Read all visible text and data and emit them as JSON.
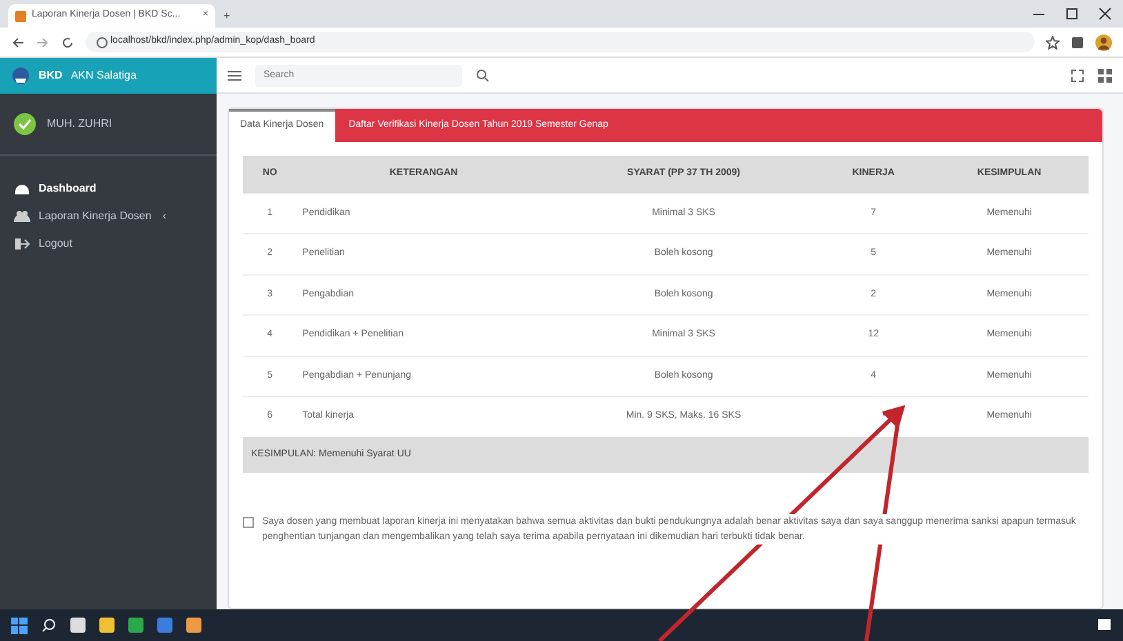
{
  "browser": {
    "tab_title": "Laporan Kinerja Dosen | BKD Sc...",
    "tab_close": "×",
    "new_tab": "+",
    "url": "localhost/bkd/index.php/admin_kop/dash_board"
  },
  "sidebar": {
    "brand": "BKD",
    "brand_sub": "AKN Salatiga",
    "user": "MUH. ZUHRI",
    "items": [
      {
        "label": "Dashboard",
        "kind": "dashboard",
        "selected": true
      },
      {
        "label": "Laporan Kinerja Dosen",
        "kind": "users",
        "selected": false,
        "caret": "‹"
      },
      {
        "label": "Logout",
        "kind": "logout",
        "selected": false
      }
    ]
  },
  "search": {
    "placeholder": "Search"
  },
  "tabs": [
    {
      "label": "Data Kinerja Dosen",
      "selected": true
    }
  ],
  "banner": "Daftar Verifikasi Kinerja Dosen Tahun 2019 Semester Genap",
  "table": {
    "columns": [
      "NO",
      "KETERANGAN",
      "SYARAT (PP 37 TH 2009)",
      "KINERJA",
      "KESIMPULAN"
    ],
    "rows": [
      [
        "1",
        "Pendidikan",
        "Minimal 3 SKS",
        "7",
        "Memenuhi"
      ],
      [
        "2",
        "Penelitian",
        "Boleh kosong",
        "5",
        "Memenuhi"
      ],
      [
        "3",
        "Pengabdian",
        "Boleh kosong",
        "2",
        "Memenuhi"
      ],
      [
        "4",
        "Pendidikan + Penelitian",
        "Minimal 3 SKS",
        "12",
        "Memenuhi"
      ],
      [
        "5",
        "Pengabdian + Penunjang",
        "Boleh kosong",
        "4",
        "Memenuhi"
      ],
      [
        "6",
        "Total kinerja",
        "Min. 9 SKS, Maks. 16 SKS",
        "",
        "Memenuhi"
      ]
    ],
    "summary": "KESIMPULAN: Memenuhi Syarat UU"
  },
  "declaration": {
    "checked": false,
    "text": "Saya dosen yang membuat laporan kinerja ini menyatakan bahwa semua aktivitas dan bukti pendukungnya adalah benar aktivitas saya dan saya sanggup menerima sanksi apapun termasuk penghentian tunjangan dan mengembalikan yang telah saya terima apabila pernyataan ini dikemudian hari terbukti tidak benar."
  }
}
